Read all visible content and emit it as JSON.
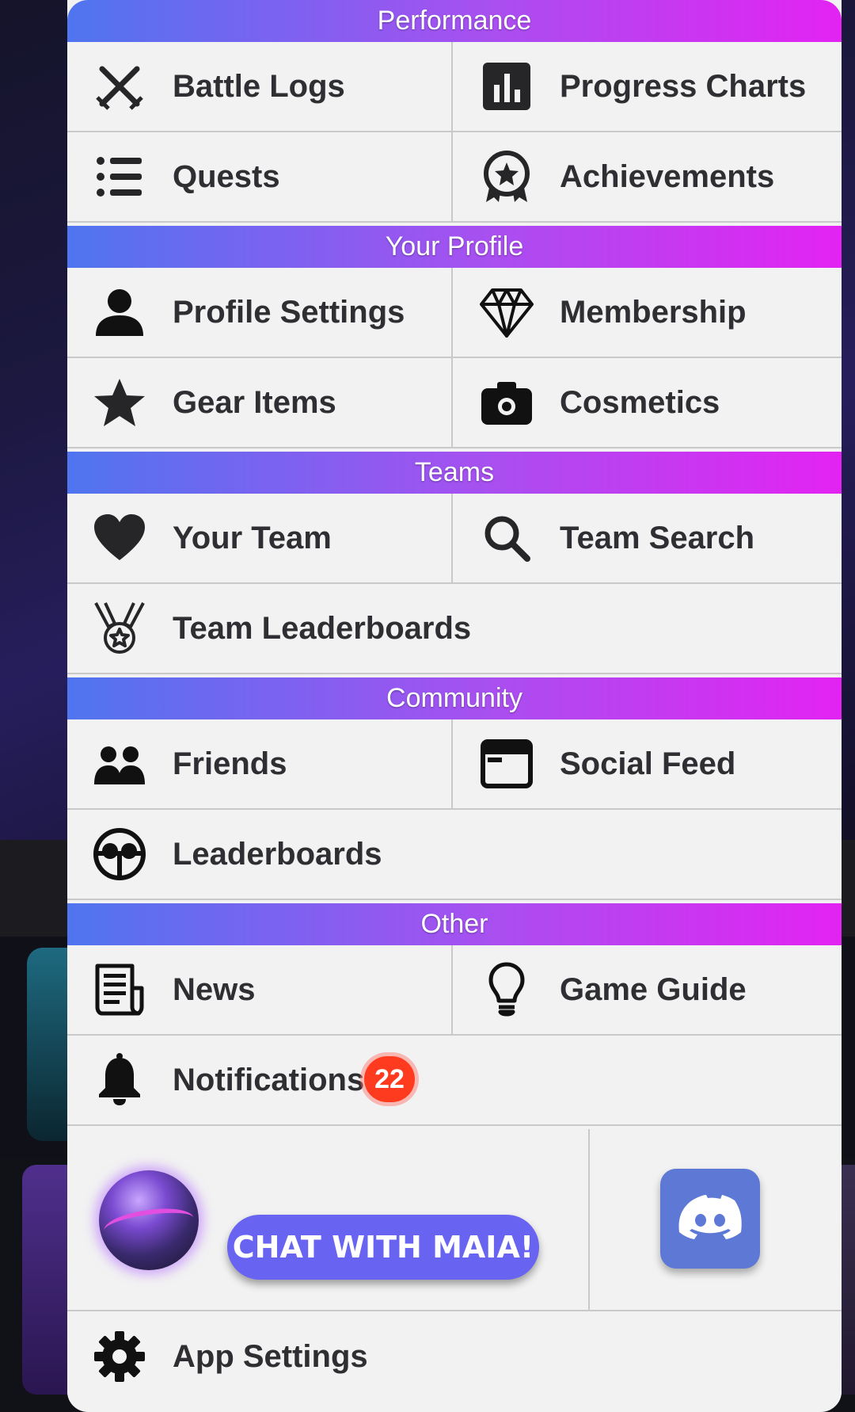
{
  "sections": {
    "performance": "Performance",
    "profile": "Your Profile",
    "teams": "Teams",
    "community": "Community",
    "other": "Other"
  },
  "items": {
    "battle_logs": "Battle Logs",
    "progress_charts": "Progress Charts",
    "quests": "Quests",
    "achievements": "Achievements",
    "profile_settings": "Profile Settings",
    "membership": "Membership",
    "gear_items": "Gear Items",
    "cosmetics": "Cosmetics",
    "your_team": "Your Team",
    "team_search": "Team Search",
    "team_leaderboards": "Team Leaderboards",
    "friends": "Friends",
    "social_feed": "Social Feed",
    "leaderboards": "Leaderboards",
    "news": "News",
    "game_guide": "Game Guide",
    "notifications": "Notifications",
    "app_settings": "App Settings"
  },
  "notifications_count": "22",
  "chat_button": "CHAT WITH MAIA!",
  "icons": {
    "battle_logs": "crossed-swords-icon",
    "progress_charts": "bar-chart-icon",
    "quests": "list-icon",
    "achievements": "star-badge-icon",
    "profile_settings": "user-icon",
    "membership": "diamond-icon",
    "gear_items": "star-icon",
    "cosmetics": "camera-icon",
    "your_team": "heart-icon",
    "team_search": "search-icon",
    "team_leaderboards": "medal-icon",
    "friends": "users-icon",
    "social_feed": "browser-window-icon",
    "leaderboards": "globe-icon",
    "news": "newspaper-icon",
    "game_guide": "lightbulb-icon",
    "notifications": "bell-icon",
    "app_settings": "gear-icon",
    "discord": "discord-icon",
    "assistant": "maia-orb-avatar"
  },
  "colors": {
    "header_gradient_start": "#4f75ef",
    "header_gradient_end": "#e323f2",
    "badge": "#ff3b1f",
    "chat_button": "#6863f0",
    "discord": "#5e78d6"
  }
}
